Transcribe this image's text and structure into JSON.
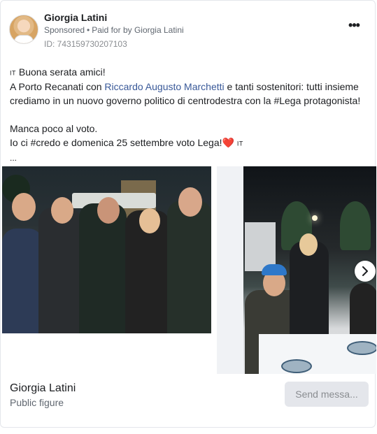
{
  "post": {
    "author": "Giorgia Latini",
    "sponsored_label": "Sponsored",
    "paid_for": "Paid for by Giorgia Latini",
    "ad_id": "ID: 743159730207103",
    "more_icon": "more-horizontal-icon"
  },
  "text": {
    "line1_flag": "IT",
    "line1": "Buona serata amici!",
    "line2_pre": "A Porto Recanati con ",
    "line2_link": "Riccardo Augusto Marchetti",
    "line2_post": " e tanti sostenitori: tutti insieme crediamo in un nuovo governo politico di centrodestra con la #Lega protagonista!",
    "line3": "Manca poco al voto.",
    "line4": "Io ci #credo e domenica 25 settembre voto Lega!",
    "line4_heart": "❤️",
    "line4_flag": "IT",
    "truncated": "..."
  },
  "carousel": {
    "next_icon": "chevron-right-icon"
  },
  "footer": {
    "page_name": "Giorgia Latini",
    "category": "Public figure",
    "send_button": "Send messa..."
  },
  "colors": {
    "link": "#385898",
    "button_bg": "#e4e6eb",
    "button_text": "#8a8d91"
  }
}
